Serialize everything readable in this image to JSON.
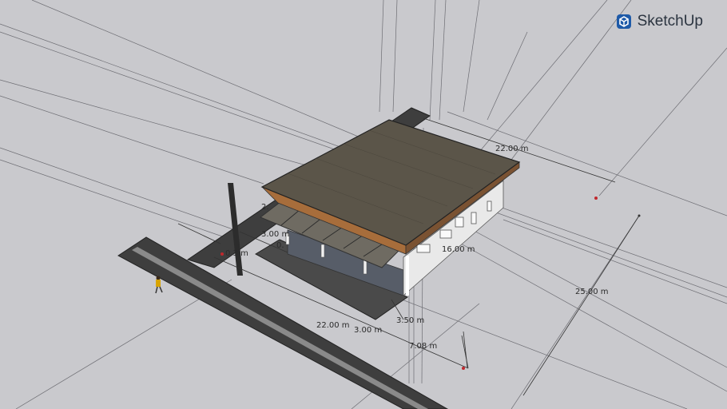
{
  "app": {
    "brand": "SketchUp",
    "logo_color": "#1e5aa8"
  },
  "dimensions": {
    "roof_width": "22.00 m",
    "side_depth": "16.00 m",
    "plot_depth": "25.00 m",
    "front_width": "22.00 m",
    "gap_a": "3.00 m",
    "gap_b": "3.50 m",
    "offset": "7.08 m",
    "canopy_depth": "3.00 m",
    "left_offset": "0.3 m",
    "small_a": "2.",
    "small_b": "0."
  },
  "colors": {
    "background": "#c9c9cd",
    "roof": "#5b5549",
    "fascia": "#a76d3b",
    "wall": "#e9e9e9",
    "road": "#3e3e3e",
    "slab": "#4c4c4c",
    "marker": "#c0282d"
  }
}
